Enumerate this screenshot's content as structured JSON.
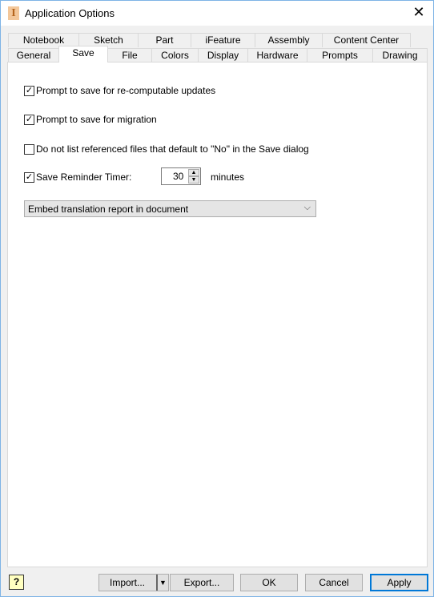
{
  "window": {
    "title": "Application Options",
    "close_icon": "close-icon"
  },
  "tabs_row1": [
    "Notebook",
    "Sketch",
    "Part",
    "iFeature",
    "Assembly",
    "Content Center"
  ],
  "tabs_row2": [
    "General",
    "Save",
    "File",
    "Colors",
    "Display",
    "Hardware",
    "Prompts",
    "Drawing"
  ],
  "selected_tab": "Save",
  "options": {
    "prompt_recompute": {
      "label": "Prompt to save for re-computable updates",
      "checked": true
    },
    "prompt_migration": {
      "label": "Prompt to save for migration",
      "checked": true
    },
    "no_list_referenced": {
      "label": "Do not list referenced files that default to \"No\" in the Save dialog",
      "checked": false
    },
    "reminder_timer": {
      "label": "Save Reminder Timer:",
      "checked": true,
      "value": "30",
      "unit": "minutes"
    }
  },
  "translation_select": {
    "value": "Embed translation report in document"
  },
  "buttons": {
    "help": "?",
    "import": "Import...",
    "export": "Export...",
    "ok": "OK",
    "cancel": "Cancel",
    "apply": "Apply"
  }
}
